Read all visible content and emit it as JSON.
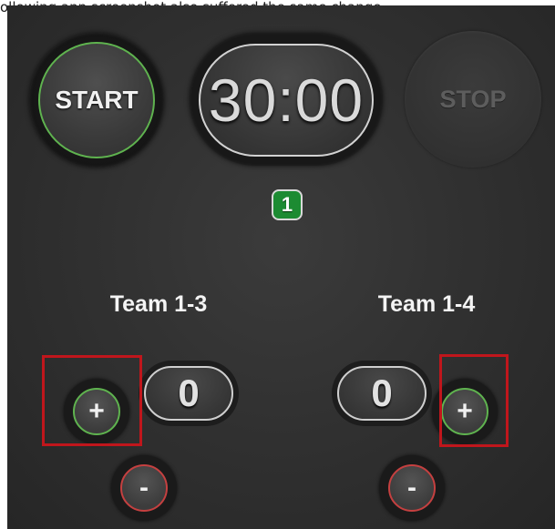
{
  "caption": "ollowing app screenshot also suffered the same change",
  "controls": {
    "start_label": "START",
    "timer_value": "30:00",
    "stop_label": "STOP",
    "period": "1"
  },
  "teams": [
    {
      "name": "Team 1-3",
      "score": "0",
      "plus_label": "+",
      "minus_label": "-"
    },
    {
      "name": "Team 1-4",
      "score": "0",
      "plus_label": "+",
      "minus_label": "-"
    }
  ],
  "colors": {
    "panel_bg": "#333333",
    "start_ring": "#5fb34f",
    "plus_ring": "#5fb34f",
    "minus_ring": "#c54040",
    "period_badge": "#1c8b32",
    "highlight_box": "#c0161c"
  }
}
